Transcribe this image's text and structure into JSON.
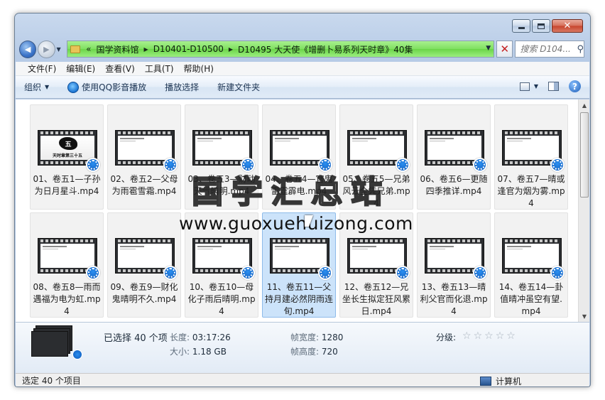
{
  "window": {
    "min_glyph": "",
    "max_glyph": "",
    "close_glyph": "✕"
  },
  "nav": {
    "back_glyph": "◀",
    "fwd_glyph": "▶",
    "drop_glyph": "▼"
  },
  "address": {
    "overflow": "«",
    "crumbs": [
      "国学资料馆",
      "D10401-D10500",
      "D10495 大天使《增删卜易系列天时章》40集"
    ],
    "separator": "▶",
    "drop": "▼",
    "refresh_glyph": "✕"
  },
  "search": {
    "placeholder": "搜索 D104...",
    "icon": "search-icon",
    "glyph": "⚲"
  },
  "menu": [
    "文件(F)",
    "编辑(E)",
    "查看(V)",
    "工具(T)",
    "帮助(H)"
  ],
  "commands": {
    "organize": "组织",
    "play_qq": "使用QQ影音播放",
    "play_select": "播放选择",
    "new_folder": "新建文件夹",
    "drop_glyph": "▼",
    "help_glyph": "?"
  },
  "files": [
    {
      "label": "01、卷五1—子孙为日月星斗.mp4",
      "cover": true,
      "cover_char": "五",
      "cover_text": "天时章第三十五"
    },
    {
      "label": "02、卷五2—父母为雨雹雪霜.mp4"
    },
    {
      "label": "03、卷五3—财动天气晴明.mp4"
    },
    {
      "label": "04、卷五4—官鬼雷霆霹电.mp4"
    },
    {
      "label": "05、卷五5—兄弟风云全凭兄弟.mp4"
    },
    {
      "label": "06、卷五6—更随四季推详.mp4"
    },
    {
      "label": "07、卷五7—晴或逢官为烟为雾.mp4"
    },
    {
      "label": "08、卷五8—雨而遇福为电为虹.mp4"
    },
    {
      "label": "09、卷五9—财化鬼晴明不久.mp4"
    },
    {
      "label": "10、卷五10—母化子雨后晴明.mp4"
    },
    {
      "label": "11、卷五11—父持月建必然阴雨连旬.mp4",
      "selected": true
    },
    {
      "label": "12、卷五12—兄坐长生拟定狂风累日.mp4"
    },
    {
      "label": "13、卷五13—晴利父官而化退.mp4"
    },
    {
      "label": "14、卷五14—卦值晴冲虽空有望.mp4"
    }
  ],
  "scroll": {
    "up": "▲",
    "down": "▼"
  },
  "watermark": {
    "title": "国学汇总站",
    "url": "www.guoxuehuizong.com"
  },
  "details": {
    "selected": "已选择 40 个项",
    "length_label": "长度:",
    "length_value": "03:17:26",
    "size_label": "大小:",
    "size_value": "1.18 GB",
    "frame_width_label": "帧宽度:",
    "frame_width_value": "1280",
    "frame_height_label": "帧高度:",
    "frame_height_value": "720",
    "rating_label": "分级:",
    "rating_value": 0,
    "star_glyph": "☆"
  },
  "status": {
    "left": "选定 40 个项目",
    "right": "计算机"
  }
}
